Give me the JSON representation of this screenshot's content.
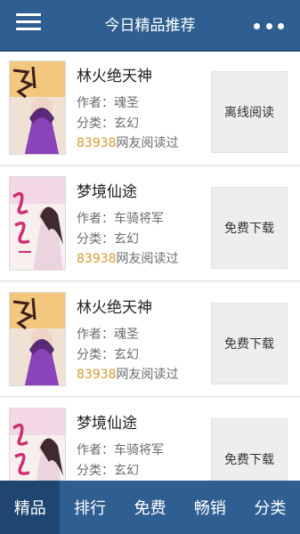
{
  "header": {
    "title": "今日精品推荐",
    "menu_icon": "menu-icon",
    "more_icon": "more-icon"
  },
  "books": [
    {
      "title": "林火绝天神",
      "author": "作者：魂圣",
      "category": "分类：玄幻",
      "reads_count": "83938",
      "reads_suffix": "网友阅读过",
      "action": "离线阅读",
      "cover_theme": "purple"
    },
    {
      "title": "梦境仙途",
      "author": "作者：车骑将军",
      "category": "分类：玄幻",
      "reads_count": "83938",
      "reads_suffix": "网友阅读过",
      "action": "免费下载",
      "cover_theme": "pink"
    },
    {
      "title": "林火绝天神",
      "author": "作者：魂圣",
      "category": "分类：玄幻",
      "reads_count": "83938",
      "reads_suffix": "网友阅读过",
      "action": "免费下载",
      "cover_theme": "purple"
    },
    {
      "title": "梦境仙途",
      "author": "作者：车骑将军",
      "category": "分类：玄幻",
      "reads_count": "",
      "reads_suffix": "",
      "action": "免费下载",
      "cover_theme": "pink"
    }
  ],
  "tabs": [
    {
      "label": "精品",
      "active": true
    },
    {
      "label": "排行",
      "active": false
    },
    {
      "label": "免费",
      "active": false
    },
    {
      "label": "畅销",
      "active": false
    },
    {
      "label": "分类",
      "active": false
    }
  ],
  "colors": {
    "header_bg": "#2f5f91",
    "tab_active_bg": "#1e4670",
    "read_count": "#d69a2d"
  }
}
